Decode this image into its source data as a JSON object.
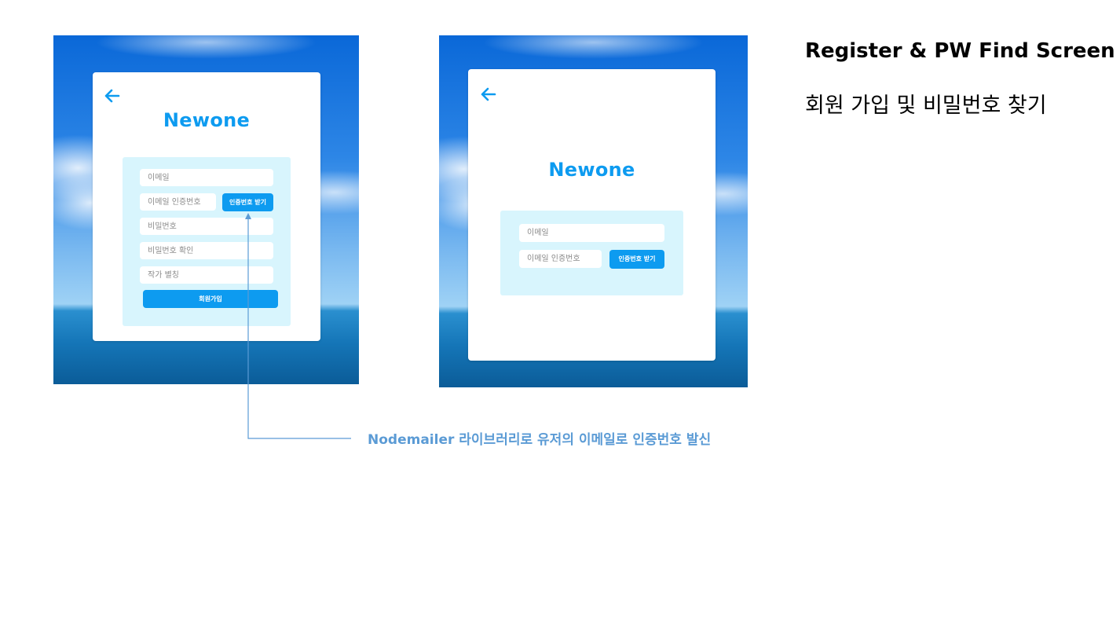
{
  "doc": {
    "heading": "Register & PW Find Screen",
    "subheading": "회원 가입 및 비밀번호 찾기",
    "annotation": "Nodemailer 라이브러리로 유저의 이메일로 인증번호 발신",
    "annotation_color": "#5b9bd5"
  },
  "register": {
    "logo": "Newone",
    "back_icon": "arrow-left-icon",
    "email_placeholder": "이메일",
    "code_placeholder": "이메일 인증번호",
    "get_code_button": "인증번호 받기",
    "password_placeholder": "비밀번호",
    "password_confirm_placeholder": "비밀번호 확인",
    "nickname_placeholder": "작가 별칭",
    "submit_button": "회원가입"
  },
  "find_password": {
    "logo": "Newone",
    "back_icon": "arrow-left-icon",
    "email_placeholder": "이메일",
    "code_placeholder": "이메일 인증번호",
    "get_code_button": "인증번호 받기"
  },
  "colors": {
    "accent": "#0d9bf0",
    "panel": "#d8f5fd",
    "card": "#ffffff"
  }
}
